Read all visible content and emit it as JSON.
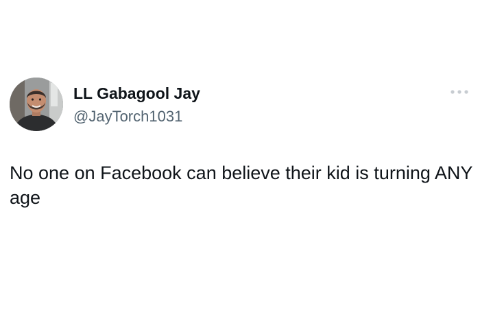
{
  "tweet": {
    "author": {
      "display_name": "LL Gabagool Jay",
      "handle": "@JayTorch1031",
      "avatar_icon": "profile-photo"
    },
    "more_icon": "more-horizontal-icon",
    "text": "No one on Facebook can believe their kid is turning ANY age"
  },
  "colors": {
    "background": "#ffffff",
    "primary_text": "#0f1419",
    "secondary_text": "#536471",
    "more_icon": "#c7ccd1"
  }
}
